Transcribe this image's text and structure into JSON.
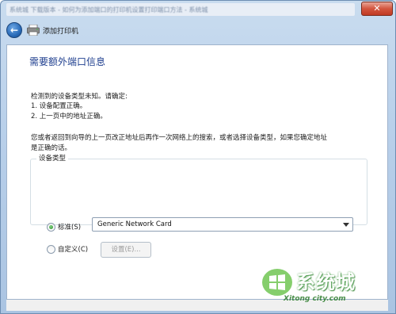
{
  "window": {
    "title_strip_text": "系统城 下载版本 - 如何为添加端口的打印机设置打印端口方法 - 系统城",
    "close_symbol": "✕"
  },
  "nav": {
    "back_symbol": "←",
    "title": "添加打印机"
  },
  "page": {
    "heading": "需要额外端口信息",
    "description_lines": [
      "检测到的设备类型未知。请确定:",
      "1. 设备配置正确。",
      "2. 上一页中的地址正确。"
    ],
    "advice_lines": [
      "您或者返回到向导的上一页改正地址后再作一次网络上的搜索，或者选择设备类型，如果您确定地址",
      "是正确的话。"
    ]
  },
  "device_type": {
    "legend": "设备类型",
    "standard_label": "标准(S)",
    "standard_selected": true,
    "custom_label": "自定义(C)",
    "custom_selected": false,
    "selected_value": "Generic Network Card",
    "settings_button": "设置(E)..."
  },
  "watermark": {
    "brand": "系统城",
    "site": "Xitong city.com"
  },
  "colors": {
    "heading": "#1f3f8f",
    "frame": "#b9d0ea",
    "close_button": "#c03a23"
  }
}
